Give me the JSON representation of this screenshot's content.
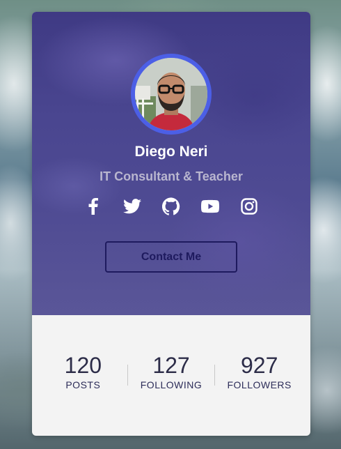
{
  "profile": {
    "name": "Diego Neri",
    "role": "IT Consultant & Teacher"
  },
  "socials": [
    {
      "icon": "facebook-icon"
    },
    {
      "icon": "twitter-icon"
    },
    {
      "icon": "github-icon"
    },
    {
      "icon": "youtube-icon"
    },
    {
      "icon": "instagram-icon"
    }
  ],
  "actions": {
    "contact_label": "Contact Me"
  },
  "stats": [
    {
      "value": "120",
      "label": "POSTS"
    },
    {
      "value": "127",
      "label": "FOLLOWING"
    },
    {
      "value": "927",
      "label": "FOLLOWERS"
    }
  ],
  "colors": {
    "card_top": "#4a4690",
    "avatar_ring": "#4c5fe6",
    "button_border": "#1e1a5e",
    "stats_bg": "#f3f3f3"
  }
}
